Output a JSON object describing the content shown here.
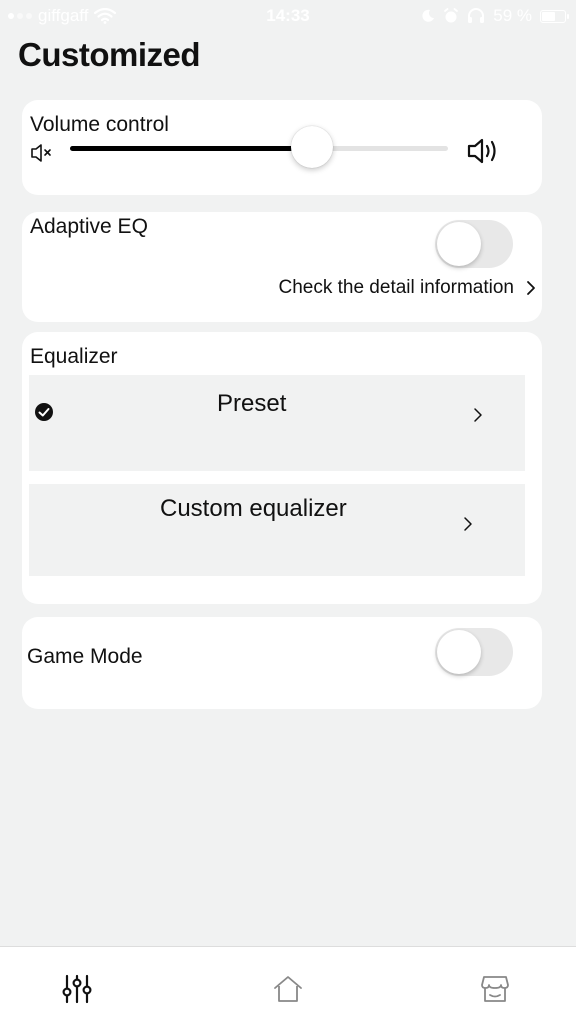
{
  "status_bar": {
    "carrier": "giffgaff",
    "time": "14:33",
    "battery": "59 %"
  },
  "page": {
    "title": "Customized"
  },
  "volume": {
    "label": "Volume control",
    "level_fraction": 0.64
  },
  "adaptive_eq": {
    "label": "Adaptive EQ",
    "enabled": false,
    "detail_link": "Check the detail information"
  },
  "equalizer": {
    "label": "Equalizer",
    "rows": [
      {
        "label": "Preset",
        "selected": true
      },
      {
        "label": "Custom equalizer",
        "selected": false
      }
    ]
  },
  "game_mode": {
    "label": "Game Mode",
    "enabled": false
  },
  "tab_bar": {
    "tabs": [
      {
        "icon": "equalizer-sliders-icon",
        "active": true
      },
      {
        "icon": "home-icon",
        "active": false
      },
      {
        "icon": "store-icon",
        "active": false
      }
    ]
  }
}
